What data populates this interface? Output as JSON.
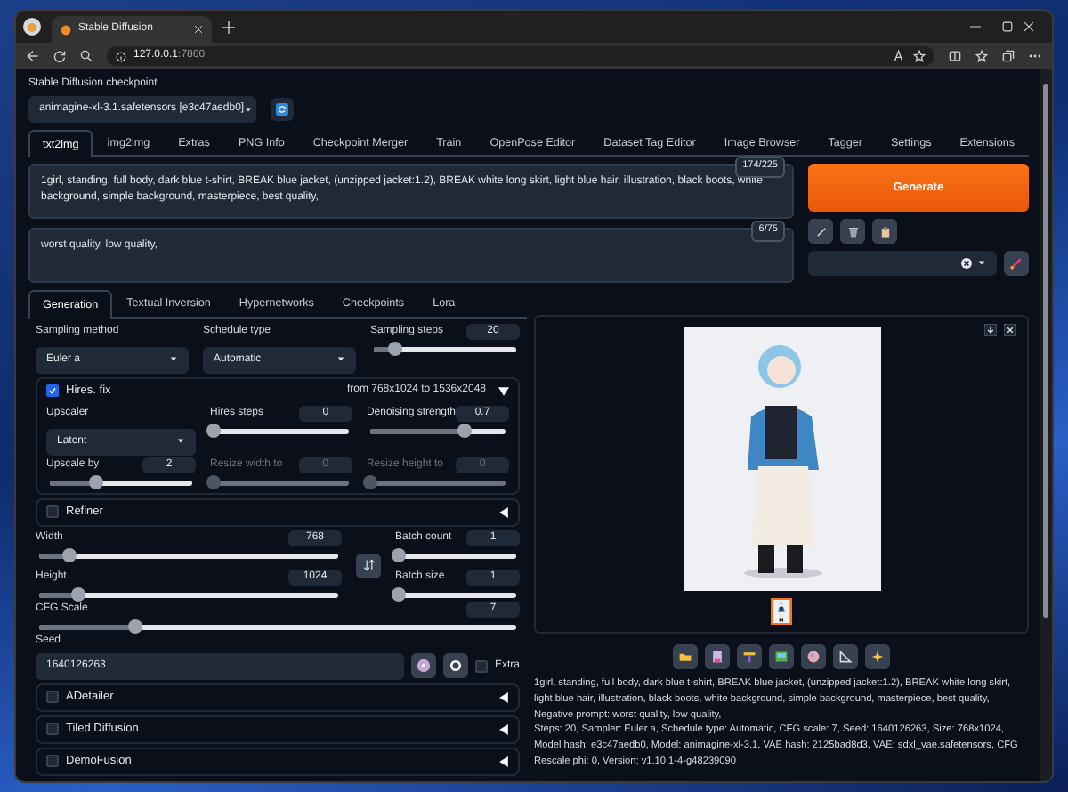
{
  "browser": {
    "tab_title": "Stable Diffusion",
    "address_host": "127.0.0.1",
    "address_port": ":7860"
  },
  "checkpoint": {
    "label": "Stable Diffusion checkpoint",
    "value": "animagine-xl-3.1.safetensors [e3c47aedb0]"
  },
  "tabs": [
    {
      "label": "txt2img",
      "selected": true
    },
    {
      "label": "img2img",
      "selected": false
    },
    {
      "label": "Extras",
      "selected": false
    },
    {
      "label": "PNG Info",
      "selected": false
    },
    {
      "label": "Checkpoint Merger",
      "selected": false
    },
    {
      "label": "Train",
      "selected": false
    },
    {
      "label": "OpenPose Editor",
      "selected": false
    },
    {
      "label": "Dataset Tag Editor",
      "selected": false
    },
    {
      "label": "Image Browser",
      "selected": false
    },
    {
      "label": "Tagger",
      "selected": false
    },
    {
      "label": "Settings",
      "selected": false
    },
    {
      "label": "Extensions",
      "selected": false
    }
  ],
  "prompt": {
    "value": "1girl, standing, full body, dark blue t-shirt, BREAK blue jacket, (unzipped jacket:1.2), BREAK white long skirt, light blue hair, illustration, black boots, white background, simple background, masterpiece, best quality,",
    "counter": "174/225"
  },
  "negative_prompt": {
    "value": "worst quality, low quality,",
    "counter": "6/75"
  },
  "generate_button": "Generate",
  "subtabs": [
    {
      "label": "Generation",
      "selected": true
    },
    {
      "label": "Textual Inversion",
      "selected": false
    },
    {
      "label": "Hypernetworks",
      "selected": false
    },
    {
      "label": "Checkpoints",
      "selected": false
    },
    {
      "label": "Lora",
      "selected": false
    }
  ],
  "sampling_method": {
    "label": "Sampling method",
    "value": "Euler a"
  },
  "schedule_type": {
    "label": "Schedule type",
    "value": "Automatic"
  },
  "sampling_steps": {
    "label": "Sampling steps",
    "value": "20",
    "level": 0.15,
    "disabled": false
  },
  "hires_fix": {
    "label": "Hires. fix",
    "checked": true,
    "expanded": true,
    "summary_from": "from 768x1024",
    "summary_to": "to 1536x2048",
    "upscaler": {
      "label": "Upscaler",
      "value": "Latent"
    },
    "sliders": [
      {
        "label": "Hires steps",
        "value": "0",
        "level": 0,
        "disabled": false
      },
      {
        "label": "Denoising strength",
        "value": "0.7",
        "level": 0.7,
        "disabled": false
      },
      {
        "label": "Upscale by",
        "value": "2",
        "level": 0.33,
        "disabled": false
      },
      {
        "label": "Resize width to",
        "value": "0",
        "level": 0,
        "disabled": true
      },
      {
        "label": "Resize height to",
        "value": "0",
        "level": 0,
        "disabled": true
      }
    ]
  },
  "refiner": {
    "label": "Refiner",
    "checked": false,
    "expanded": false
  },
  "width": {
    "label": "Width",
    "value": "768",
    "level": 0.1,
    "disabled": false
  },
  "height": {
    "label": "Height",
    "value": "1024",
    "level": 0.13,
    "disabled": false
  },
  "batch_count": {
    "label": "Batch count",
    "value": "1",
    "level": 0,
    "disabled": false
  },
  "batch_size": {
    "label": "Batch size",
    "value": "1",
    "level": 0,
    "disabled": false
  },
  "cfg_scale": {
    "label": "CFG Scale",
    "value": "7",
    "level": 0.2,
    "disabled": false
  },
  "seed": {
    "label": "Seed",
    "value": "1640126263",
    "extra_label": "Extra",
    "extra_checked": false
  },
  "scripts": [
    {
      "label": "ADetailer",
      "checked": false,
      "expanded": false
    },
    {
      "label": "Tiled Diffusion",
      "checked": false,
      "expanded": false
    },
    {
      "label": "DemoFusion",
      "checked": false,
      "expanded": false
    }
  ],
  "output": {
    "thumbnails": [
      {
        "selected": true
      }
    ],
    "info": [
      "1girl, standing, full body, dark blue t-shirt, BREAK blue jacket, (unzipped jacket:1.2), BREAK white long skirt, light blue hair, illustration, black boots, white background, simple background, masterpiece, best quality,",
      "Negative prompt: worst quality, low quality,",
      "Steps: 20, Sampler: Euler a, Schedule type: Automatic, CFG scale: 7, Seed: 1640126263, Size: 768x1024, Model hash: e3c47aedb0, Model: animagine-xl-3.1, VAE hash: 2125bad8d3, VAE: sdxl_vae.safetensors, CFG Rescale phi: 0, Version: v1.10.1-4-g48239090"
    ]
  }
}
